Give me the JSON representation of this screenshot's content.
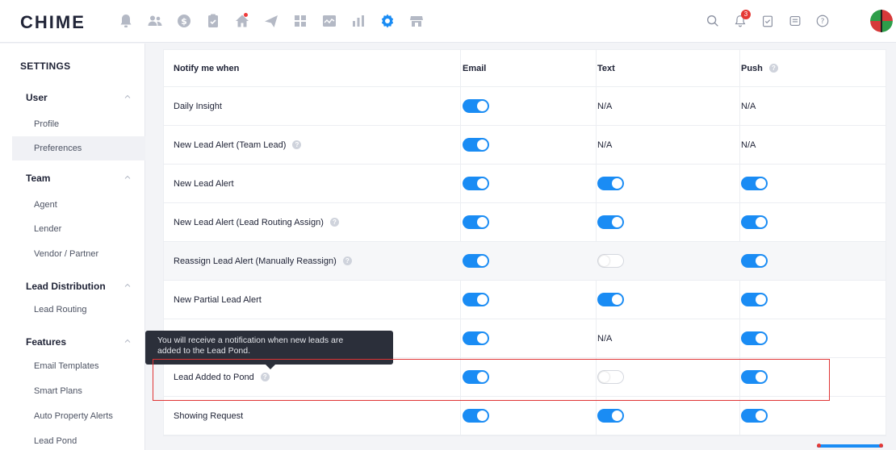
{
  "app": {
    "logo": "CHIME"
  },
  "nav": {
    "icons": [
      "bell-icon",
      "people-icon",
      "dollar-icon",
      "clipboard-icon",
      "home-icon",
      "send-icon",
      "grid-icon",
      "chart-line-icon",
      "bar-chart-icon",
      "settings-icon",
      "store-icon"
    ],
    "active": "settings-icon"
  },
  "topright": {
    "notification_count": "3",
    "icons": [
      "search-icon",
      "notification-bell-icon",
      "task-icon",
      "message-icon",
      "help-icon",
      "avatar"
    ]
  },
  "sidebar": {
    "title": "SETTINGS",
    "groups": [
      {
        "label": "User",
        "items": [
          "Profile",
          "Preferences"
        ]
      },
      {
        "label": "Team",
        "items": [
          "Agent",
          "Lender",
          "Vendor / Partner"
        ]
      },
      {
        "label": "Lead Distribution",
        "items": [
          "Lead Routing"
        ]
      },
      {
        "label": "Features",
        "items": [
          "Email Templates",
          "Smart Plans",
          "Auto Property Alerts",
          "Lead Pond"
        ]
      }
    ],
    "active_item": "Preferences"
  },
  "table": {
    "headers": {
      "name": "Notify me when",
      "email": "Email",
      "text": "Text",
      "push": "Push"
    },
    "rows": [
      {
        "name": "Daily Insight",
        "help": false,
        "email": "on",
        "text": "N/A",
        "push": "N/A"
      },
      {
        "name": "New Lead Alert (Team Lead)",
        "help": true,
        "email": "on",
        "text": "N/A",
        "push": "N/A"
      },
      {
        "name": "New Lead Alert",
        "help": false,
        "email": "on",
        "text": "on",
        "push": "on"
      },
      {
        "name": "New Lead Alert (Lead Routing Assign)",
        "help": true,
        "email": "on",
        "text": "on",
        "push": "on"
      },
      {
        "name": "Reassign Lead Alert (Manually Reassign)",
        "help": true,
        "email": "on",
        "text": "off",
        "push": "on"
      },
      {
        "name": "New Partial Lead Alert",
        "help": false,
        "email": "on",
        "text": "on",
        "push": "on"
      },
      {
        "name": "",
        "help": false,
        "email": "on",
        "text": "N/A",
        "push": "on"
      },
      {
        "name": "Lead Added to Pond",
        "help": true,
        "email": "on",
        "text": "off",
        "push": "on"
      },
      {
        "name": "Showing Request",
        "help": false,
        "email": "on",
        "text": "on",
        "push": "on"
      }
    ]
  },
  "tooltip": {
    "line1": "You will receive a notification when new leads are",
    "line2": "added to the Lead Pond."
  },
  "colors": {
    "accent": "#1a8cf4",
    "highlight": "#e03434",
    "tooltip_bg": "#2b2f3a"
  }
}
